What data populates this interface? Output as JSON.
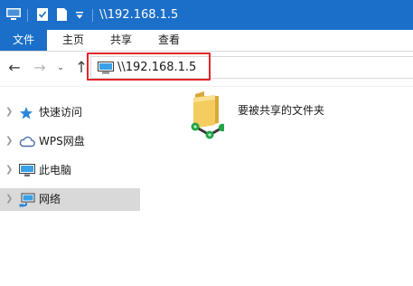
{
  "titlebar": {
    "title": "\\\\192.168.1.5",
    "icons": [
      "computer-icon",
      "properties-icon",
      "new-folder-icon",
      "customize-dropdown-icon"
    ],
    "color": "#1b6fc8"
  },
  "ribbon": {
    "tabs": [
      {
        "label": "文件",
        "active": true
      },
      {
        "label": "主页"
      },
      {
        "label": "共享"
      },
      {
        "label": "查看"
      }
    ]
  },
  "nav": {
    "back": "←",
    "forward": "→",
    "recent": "⌄",
    "up": "↑"
  },
  "address": {
    "value": "\\\\192.168.1.5",
    "icon": "network-computer-icon",
    "highlight_color": "#e0262b"
  },
  "sidebar": {
    "items": [
      {
        "label": "快速访问",
        "icon": "star-icon"
      },
      {
        "label": "WPS网盘",
        "icon": "cloud-icon"
      },
      {
        "label": "此电脑",
        "icon": "monitor-icon"
      },
      {
        "label": "网络",
        "icon": "network-icon",
        "selected": true
      }
    ]
  },
  "content": {
    "items": [
      {
        "label": "要被共享的文件夹",
        "icon": "shared-folder-icon"
      }
    ]
  }
}
